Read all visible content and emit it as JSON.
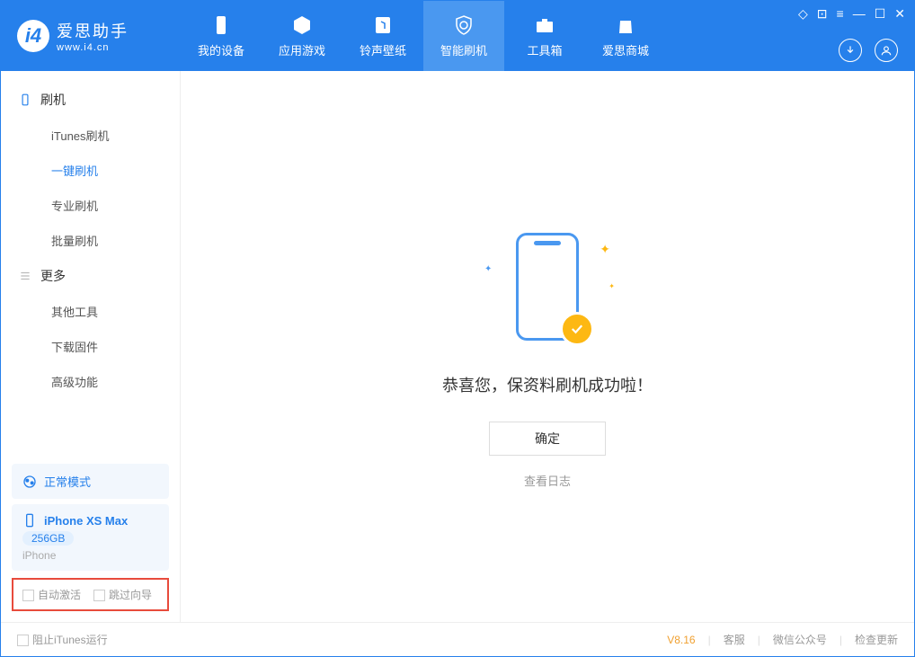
{
  "app": {
    "name": "爱思助手",
    "url": "www.i4.cn"
  },
  "tabs": {
    "device": "我的设备",
    "apps": "应用游戏",
    "ringtone": "铃声壁纸",
    "flash": "智能刷机",
    "toolbox": "工具箱",
    "store": "爱思商城"
  },
  "sidebar": {
    "group1": "刷机",
    "items1": {
      "itunes": "iTunes刷机",
      "oneclick": "一键刷机",
      "pro": "专业刷机",
      "batch": "批量刷机"
    },
    "group2": "更多",
    "items2": {
      "other": "其他工具",
      "firmware": "下载固件",
      "advanced": "高级功能"
    }
  },
  "mode": {
    "label": "正常模式"
  },
  "device": {
    "name": "iPhone XS Max",
    "storage": "256GB",
    "type": "iPhone"
  },
  "options": {
    "auto_activate": "自动激活",
    "skip_guide": "跳过向导"
  },
  "main": {
    "message": "恭喜您，保资料刷机成功啦！",
    "ok": "确定",
    "viewlog": "查看日志"
  },
  "status": {
    "block_itunes": "阻止iTunes运行",
    "version": "V8.16",
    "support": "客服",
    "wechat": "微信公众号",
    "update": "检查更新"
  }
}
